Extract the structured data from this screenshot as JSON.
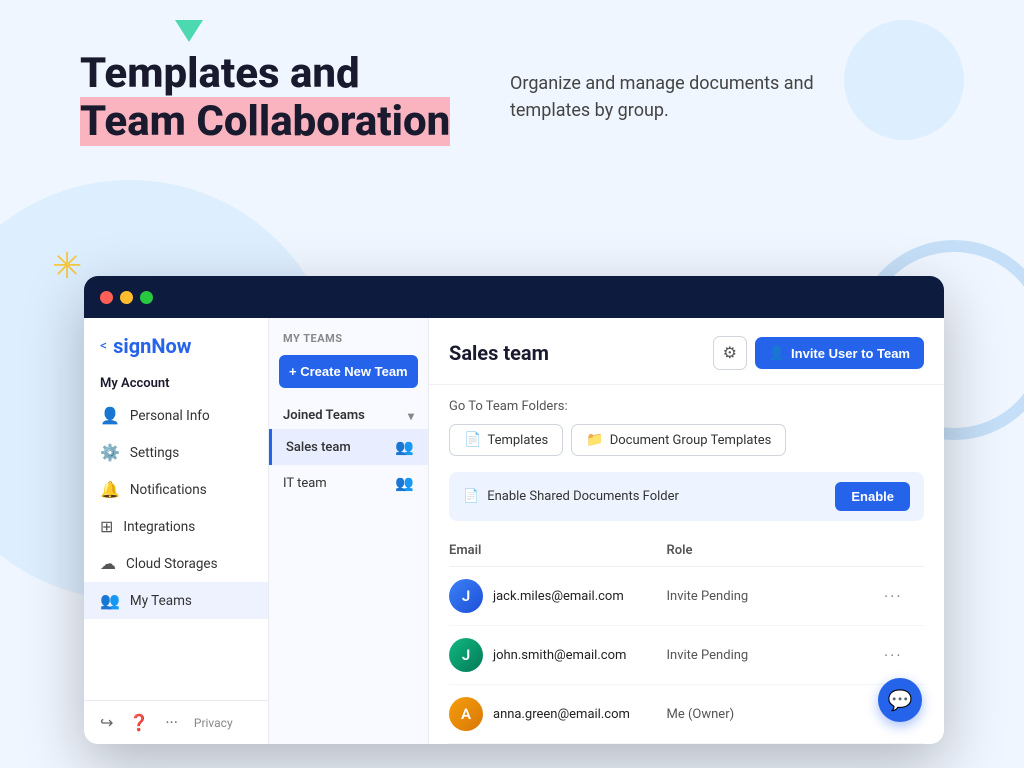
{
  "page": {
    "headline_line1": "Templates and",
    "headline_line2": "Team Collaboration",
    "subtext": "Organize and manage documents and templates by group."
  },
  "sidebar": {
    "brand": "signNow",
    "back_label": "<",
    "account_title": "My Account",
    "nav_items": [
      {
        "label": "Personal Info",
        "icon": "👤"
      },
      {
        "label": "Settings",
        "icon": "⚙️"
      },
      {
        "label": "Notifications",
        "icon": "🔔"
      },
      {
        "label": "Integrations",
        "icon": "⊞"
      },
      {
        "label": "Cloud Storages",
        "icon": "☁"
      },
      {
        "label": "My Teams",
        "icon": "👥",
        "active": true
      }
    ],
    "footer": {
      "privacy_label": "Privacy"
    }
  },
  "teams_panel": {
    "section_title": "MY TEAMS",
    "create_button": "+ Create New Team",
    "joined_teams_label": "Joined Teams",
    "teams": [
      {
        "name": "Sales team",
        "selected": true
      },
      {
        "name": "IT team",
        "selected": false
      }
    ]
  },
  "main": {
    "team_title": "Sales team",
    "gear_icon": "⚙",
    "invite_button_icon": "👤",
    "invite_button_label": "Invite User to Team",
    "folders_label": "Go To Team Folders:",
    "folder_tabs": [
      {
        "icon": "📄",
        "label": "Templates"
      },
      {
        "icon": "📁",
        "label": "Document Group Templates"
      }
    ],
    "shared_folder": {
      "icon": "📄",
      "label": "Enable Shared Documents Folder",
      "button_label": "Enable"
    },
    "table_headers": {
      "email": "Email",
      "role": "Role"
    },
    "members": [
      {
        "email": "jack.miles@email.com",
        "role": "Invite Pending",
        "initials": "J",
        "color": "blue"
      },
      {
        "email": "john.smith@email.com",
        "role": "Invite Pending",
        "initials": "J",
        "color": "green"
      },
      {
        "email": "anna.green@email.com",
        "role": "Me (Owner)",
        "initials": "A",
        "color": "orange"
      }
    ]
  },
  "chat_fab_icon": "💬"
}
